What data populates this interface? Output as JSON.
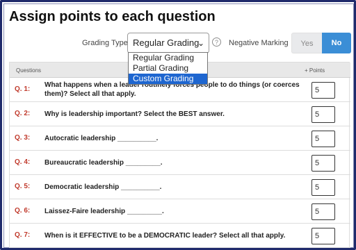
{
  "page": {
    "title": "Assign points to each question"
  },
  "controls": {
    "grading_type_label": "Grading Type",
    "grading_type_value": "Regular Grading",
    "negative_marking_label": "Negative Marking",
    "toggle_yes": "Yes",
    "toggle_no": "No",
    "toggle_selected": "No"
  },
  "dropdown": {
    "options": [
      "Regular Grading",
      "Partial Grading",
      "Custom Grading"
    ],
    "highlighted": "Custom Grading"
  },
  "table": {
    "headers": {
      "questions": "Questions",
      "points": "+ Points"
    },
    "rows": [
      {
        "num": "Q. 1:",
        "text": "What happens when a leader routinely forces people to do things (or coerces them)? Select all that apply.",
        "points": "5"
      },
      {
        "num": "Q. 2:",
        "text": "Why is leadership important? Select the BEST answer.",
        "points": "5"
      },
      {
        "num": "Q. 3:",
        "text": "Autocratic leadership __________.",
        "points": "5"
      },
      {
        "num": "Q. 4:",
        "text": "Bureaucratic leadership _________.",
        "points": "5"
      },
      {
        "num": "Q. 5:",
        "text": "Democratic leadership __________.",
        "points": "5"
      },
      {
        "num": "Q. 6:",
        "text": "Laissez-Faire leadership _________.",
        "points": "5"
      },
      {
        "num": "Q. 7:",
        "text": "When is it EFFECTIVE to be a DEMOCRATIC leader? Select all that apply.",
        "points": "5"
      }
    ]
  },
  "colors": {
    "accent": "#3b8ed6",
    "question_number": "#c0392b",
    "frame": "#1f2a6b",
    "dropdown_highlight": "#1e66d0"
  },
  "icons": {
    "help": "question-circle-icon",
    "select_arrow": "chevron-down-icon"
  }
}
